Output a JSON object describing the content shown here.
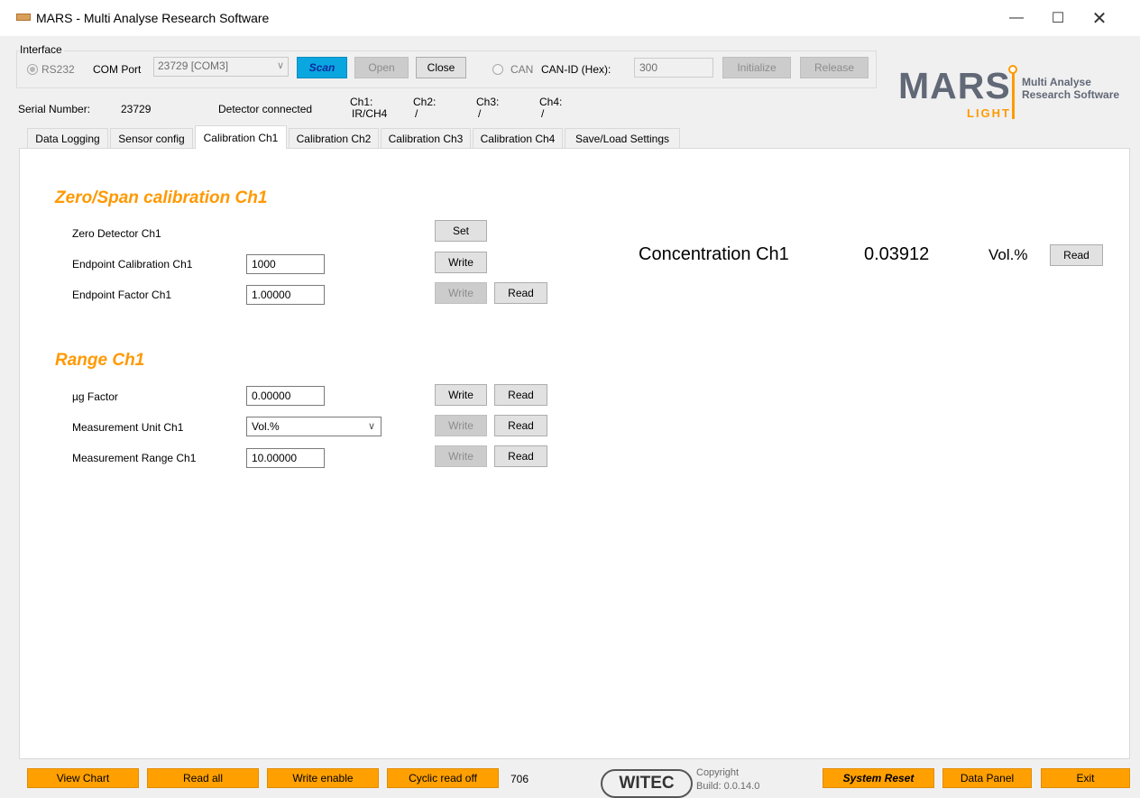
{
  "window": {
    "title": "MARS - Multi Analyse Research Software",
    "minimize_icon": "minimize-icon",
    "maximize_icon": "maximize-icon",
    "close_icon": "close-icon"
  },
  "interface": {
    "group_label": "Interface",
    "rs232_label": "RS232",
    "com_port_label": "COM Port",
    "com_port_value": "23729 [COM3]",
    "scan_label": "Scan",
    "open_label": "Open",
    "close_label": "Close",
    "can_label": "CAN",
    "can_id_label": "CAN-ID (Hex):",
    "can_id_value": "300",
    "initialize_label": "Initialize",
    "release_label": "Release"
  },
  "status": {
    "serial_label": "Serial Number:",
    "serial_value": "23729",
    "detector_status": "Detector connected",
    "ch1_label": "Ch1:",
    "ch1_value": "IR/CH4",
    "ch2_label": "Ch2:",
    "ch2_value": "/",
    "ch3_label": "Ch3:",
    "ch3_value": "/",
    "ch4_label": "Ch4:",
    "ch4_value": "/"
  },
  "logo": {
    "mars": "MARS",
    "light": "LIGHT",
    "line1": "Multi Analyse",
    "line2": "Research Software"
  },
  "tabs": [
    {
      "label": "Data Logging"
    },
    {
      "label": "Sensor config"
    },
    {
      "label": "Calibration Ch1",
      "active": true
    },
    {
      "label": "Calibration Ch2"
    },
    {
      "label": "Calibration Ch3"
    },
    {
      "label": "Calibration Ch4"
    },
    {
      "label": "Save/Load Settings"
    }
  ],
  "zero_span": {
    "title": "Zero/Span calibration Ch1",
    "zero_label": "Zero Detector Ch1",
    "set_label": "Set",
    "endpoint_cal_label": "Endpoint Calibration Ch1",
    "endpoint_cal_value": "1000",
    "endpoint_factor_label": "Endpoint Factor Ch1",
    "endpoint_factor_value": "1.00000",
    "write_label": "Write",
    "read_label": "Read"
  },
  "concentration": {
    "label": "Concentration Ch1",
    "value": "0.03912",
    "unit": "Vol.%",
    "read_label": "Read"
  },
  "range": {
    "title": "Range Ch1",
    "ug_factor_label": "µg Factor",
    "ug_factor_value": "0.00000",
    "unit_label": "Measurement Unit Ch1",
    "unit_value": "Vol.%",
    "range_label": "Measurement Range Ch1",
    "range_value": "10.00000",
    "write_label": "Write",
    "read_label": "Read"
  },
  "footer": {
    "view_chart": "View Chart",
    "read_all": "Read all",
    "write_enable": "Write enable",
    "cyclic_read": "Cyclic read off",
    "counter": "706",
    "witec_logo": "WITEC",
    "copyright": "Copyright",
    "build": "Build: 0.0.14.0",
    "system_reset": "System Reset",
    "data_panel": "Data Panel",
    "exit": "Exit"
  },
  "colors": {
    "accent_orange": "#ffa000",
    "section_orange": "#ff9900",
    "scan_blue": "#0aa6e0",
    "logo_gray": "#616876"
  }
}
